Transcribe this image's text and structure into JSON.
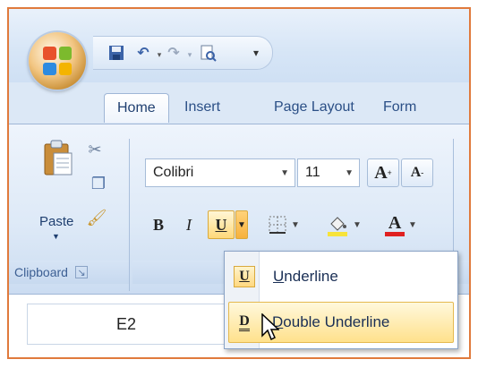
{
  "quick_access": {
    "icons": [
      "office-button-icon",
      "save-icon",
      "undo-icon",
      "redo-icon",
      "print-preview-icon",
      "customize-qat-icon"
    ]
  },
  "tabs": [
    {
      "label": "Home",
      "active": true
    },
    {
      "label": "Insert",
      "active": false
    },
    {
      "label": "Page Layout",
      "active": false
    },
    {
      "label": "Form",
      "active": false
    }
  ],
  "clipboard": {
    "paste_label": "Paste",
    "group_label": "Clipboard",
    "icons": [
      "paste-icon",
      "cut-icon",
      "copy-icon",
      "format-painter-icon",
      "dialog-launcher-icon"
    ]
  },
  "font": {
    "font_name": "Colibri",
    "font_size": "11",
    "grow_label": "A",
    "shrink_label": "A",
    "bold": "B",
    "italic": "I",
    "underline": "U",
    "font_color_letter": "A",
    "highlight_color": "#f7e33a",
    "font_color": "#e02020"
  },
  "underline_menu": {
    "items": [
      {
        "icon_letter": "U",
        "label_accel": "U",
        "label_rest": "nderline",
        "highlighted": false
      },
      {
        "icon_letter": "D",
        "label_accel": "D",
        "label_rest": "ouble Underline",
        "highlighted": true
      }
    ]
  },
  "namebox": {
    "value": "E2"
  }
}
